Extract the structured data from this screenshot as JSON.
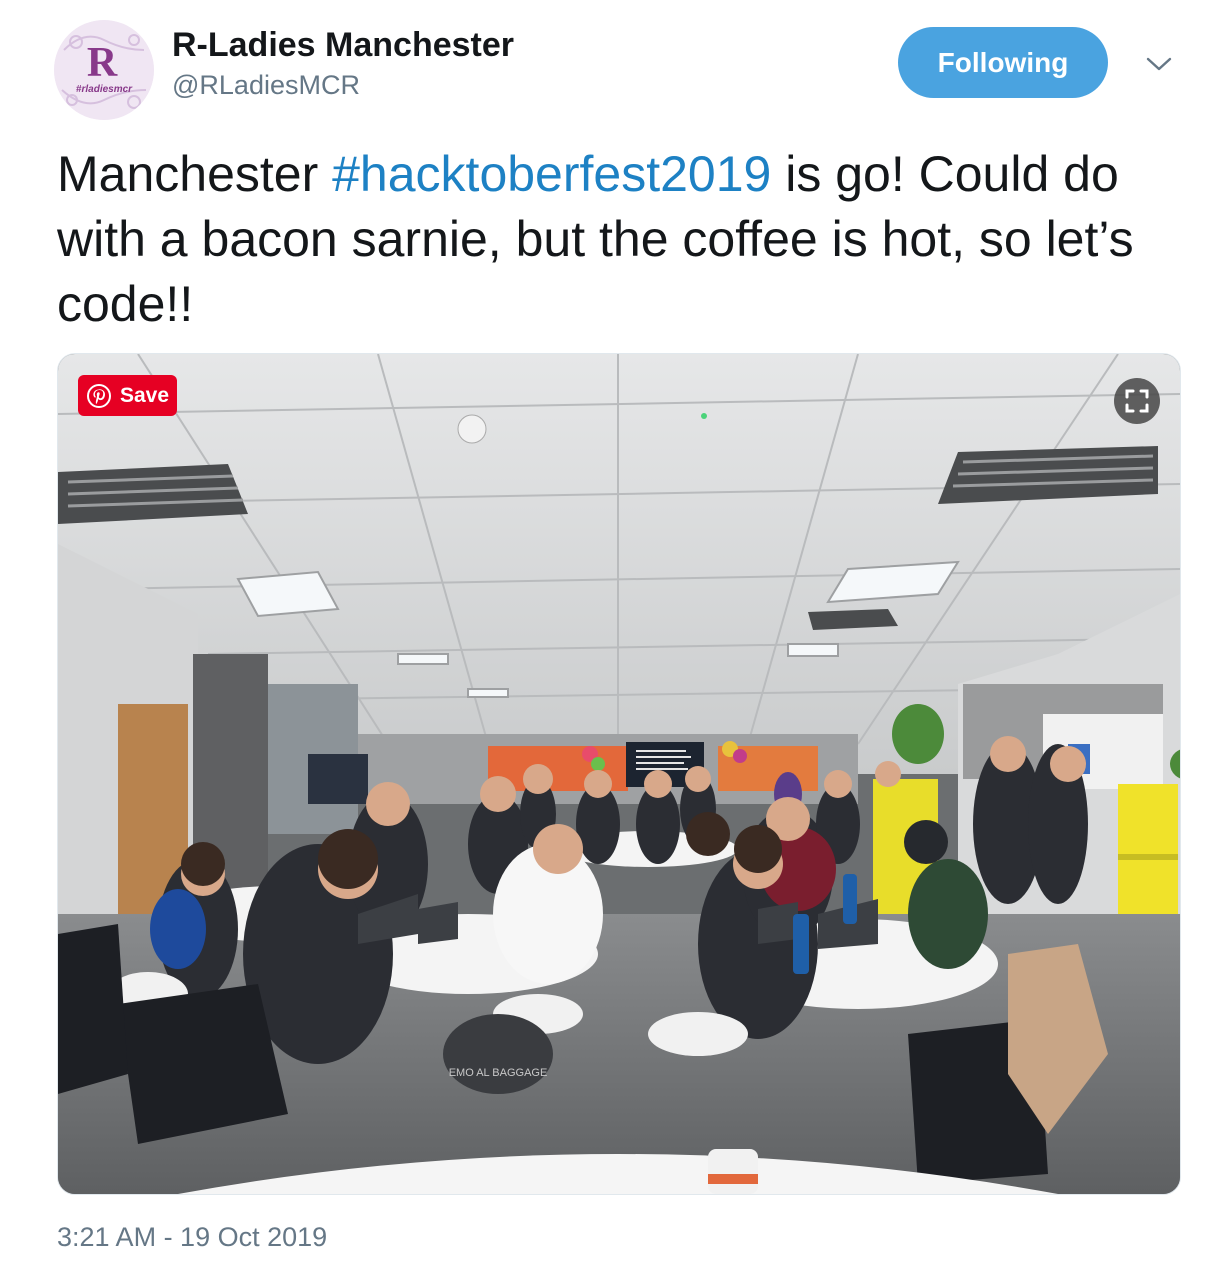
{
  "account": {
    "name": "R-Ladies Manchester",
    "handle": "@RLadiesMCR",
    "avatar_letter": "R",
    "avatar_tag": "#rladiesmcr"
  },
  "follow_button": {
    "label": "Following",
    "color": "#4aa3e0"
  },
  "menu_chevron_icon": "chevron-down-icon",
  "tweet": {
    "text_before": "Manchester ",
    "hashtag": "#hacktoberfest2019",
    "text_after": " is go! Could do with a bacon sarnie, but the coffee is hot, so let’s code!!",
    "hashtag_color": "#1d81c4"
  },
  "media": {
    "save_label": "Save",
    "save_icon": "pinterest-icon",
    "expand_icon": "expand-icon",
    "bag_text": "EMO  AL BAGGAGE"
  },
  "timestamp": "3:21 AM - 19 Oct 2019"
}
